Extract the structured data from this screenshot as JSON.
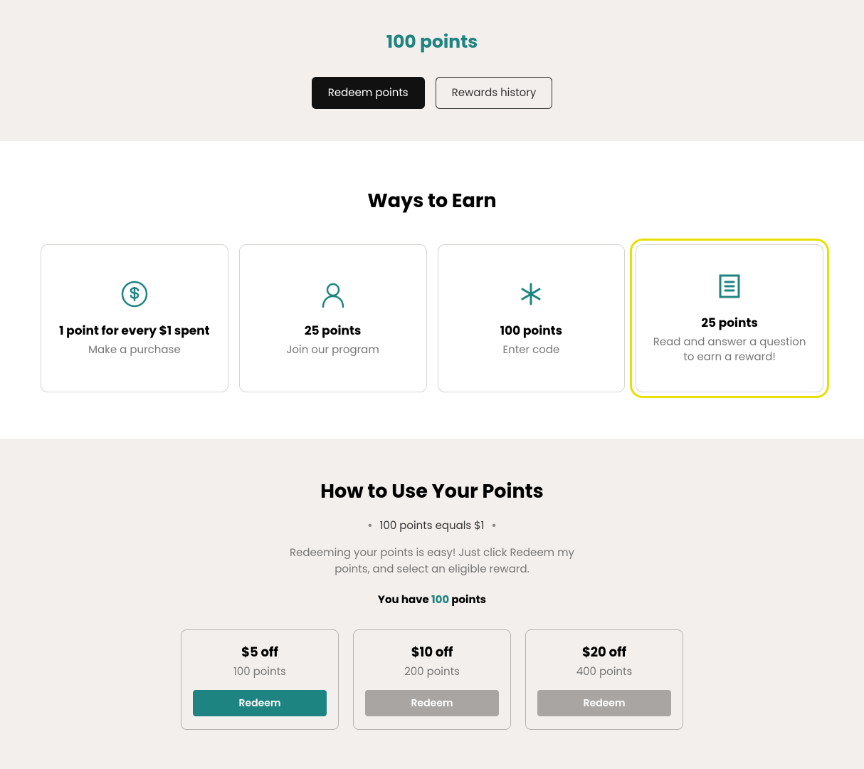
{
  "header": {
    "points_balance": "100 points",
    "redeem_button": "Redeem points",
    "history_button": "Rewards history"
  },
  "earn": {
    "title": "Ways to Earn",
    "cards": [
      {
        "title": "1 point for every $1 spent",
        "desc": "Make a purchase"
      },
      {
        "title": "25 points",
        "desc": "Join our program"
      },
      {
        "title": "100 points",
        "desc": "Enter code"
      },
      {
        "title": "25 points",
        "desc": "Read and answer a question to earn a reward!"
      }
    ]
  },
  "use": {
    "title": "How to Use Your Points",
    "conversion": "100 points equals $1",
    "desc": "Redeeming your points is easy! Just click Redeem my points, and select an eligible reward.",
    "you_have_prefix": "You have ",
    "you_have_value": "100",
    "you_have_suffix": " points",
    "rewards": [
      {
        "title": "$5 off",
        "cost": "100 points",
        "button": "Redeem",
        "enabled": true
      },
      {
        "title": "$10 off",
        "cost": "200 points",
        "button": "Redeem",
        "enabled": false
      },
      {
        "title": "$20 off",
        "cost": "400 points",
        "button": "Redeem",
        "enabled": false
      }
    ]
  },
  "colors": {
    "accent": "#1e8481",
    "highlight_ring": "#e8e000"
  }
}
